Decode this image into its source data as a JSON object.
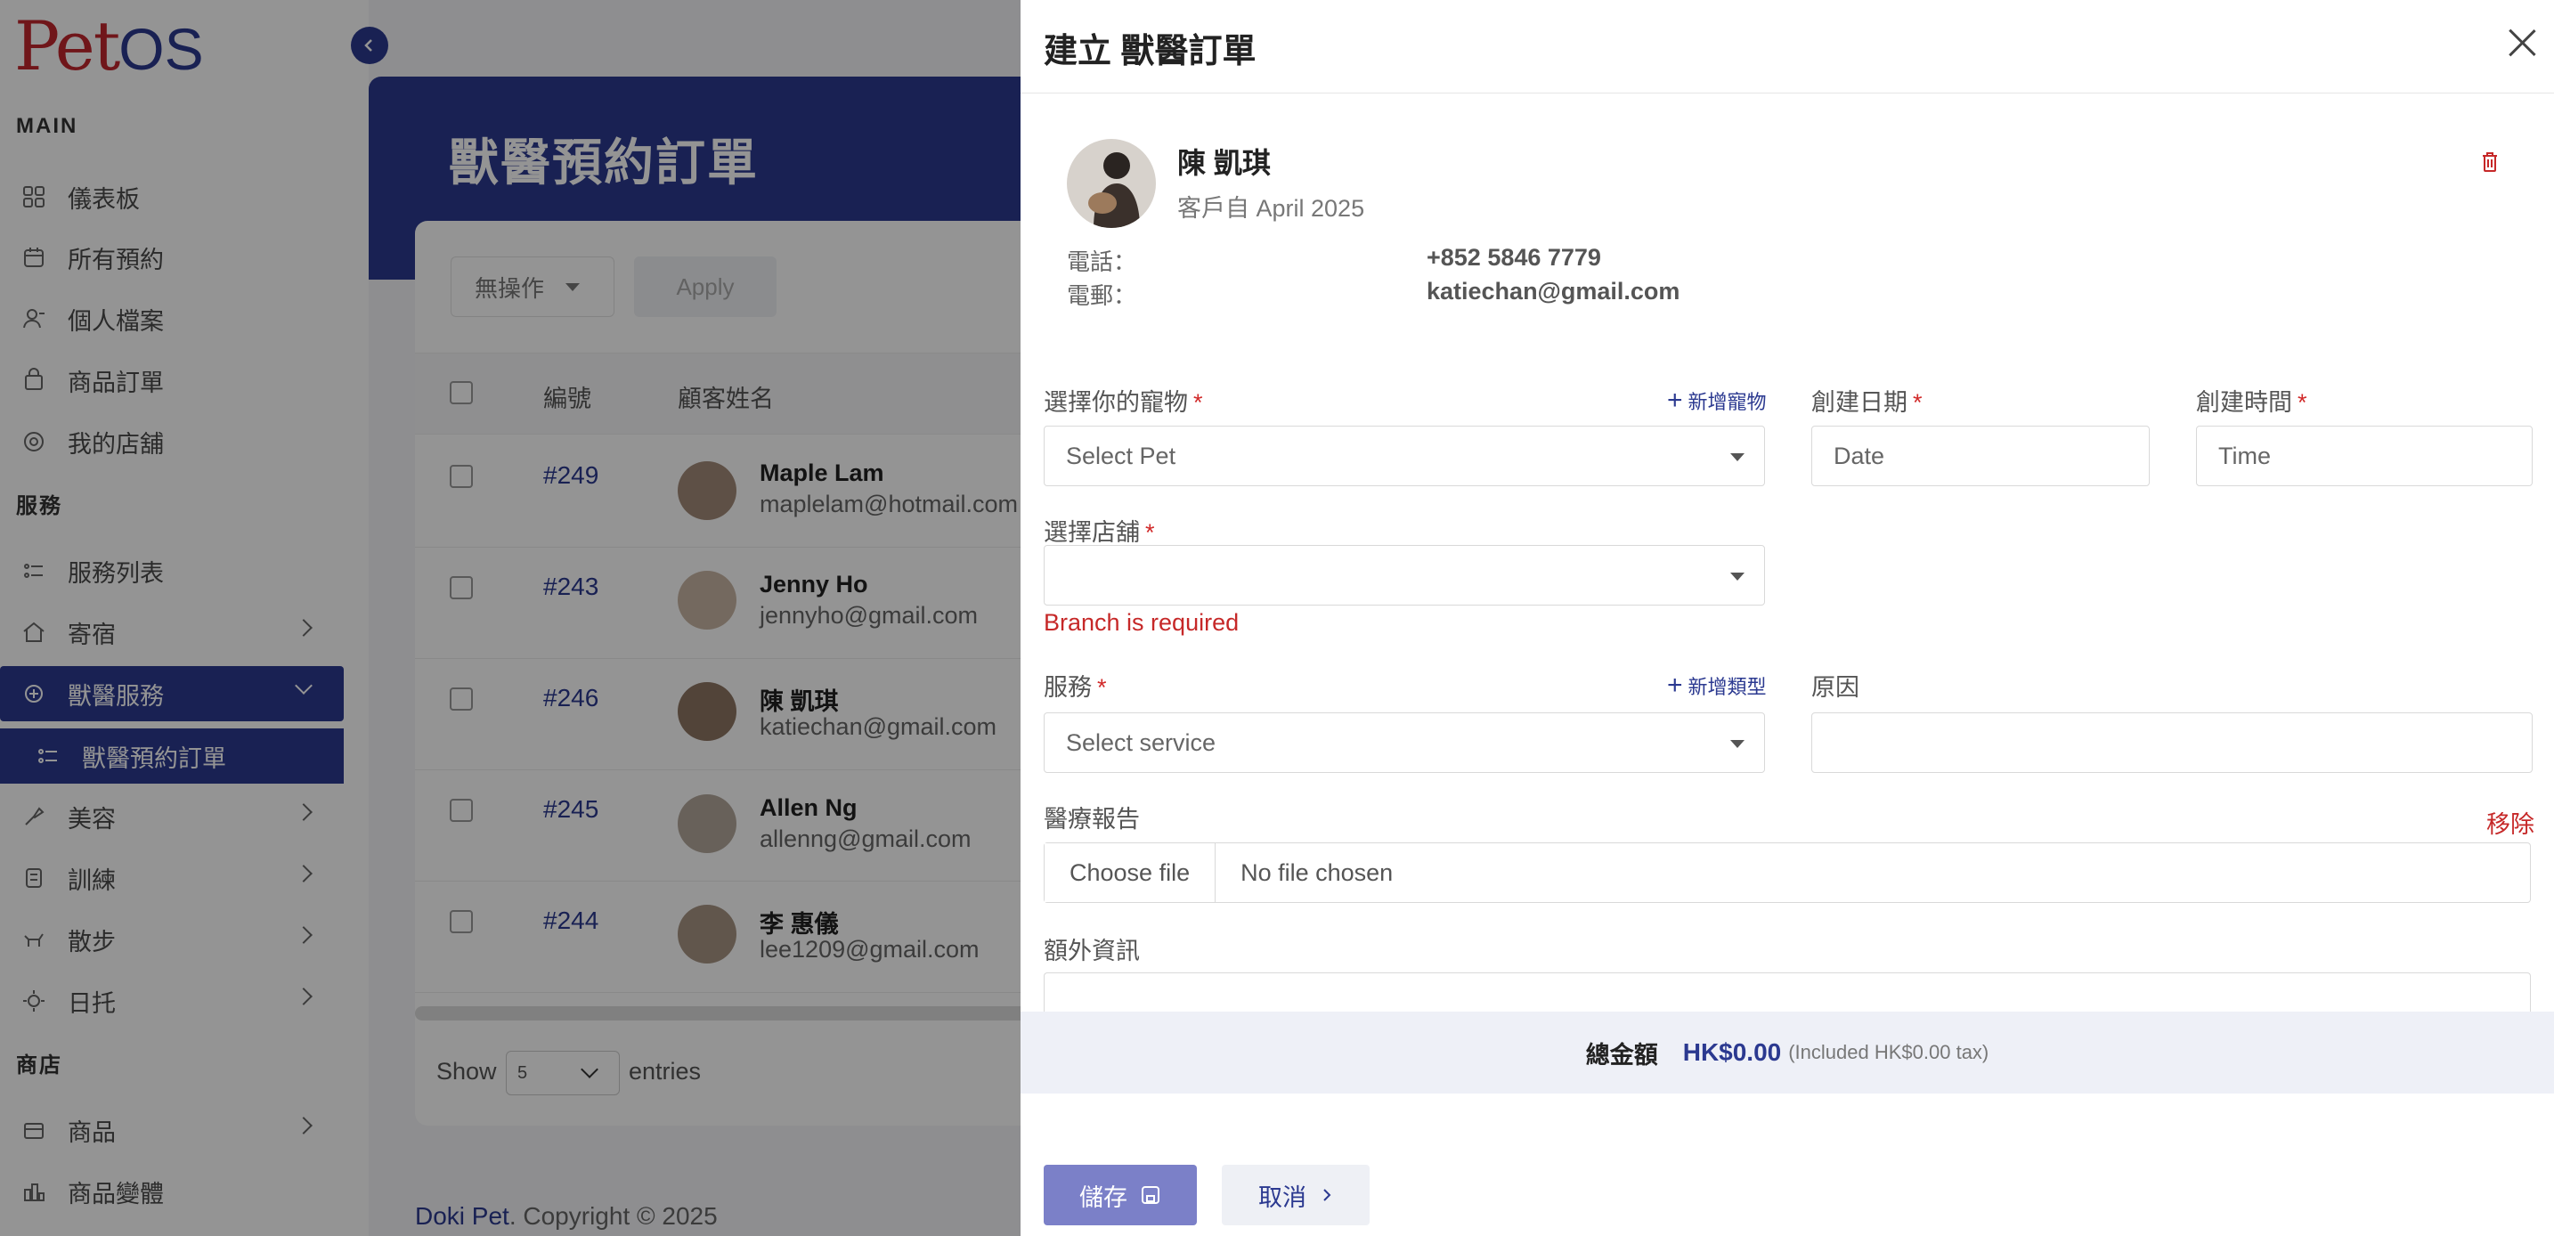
{
  "sidebar": {
    "logo_text": "Pet",
    "logo_suffix": "OS",
    "sections": {
      "main": "MAIN",
      "services": "服務",
      "shop": "商店"
    },
    "items": [
      {
        "label": "儀表板"
      },
      {
        "label": "所有預約"
      },
      {
        "label": "個人檔案"
      },
      {
        "label": "商品訂單"
      },
      {
        "label": "我的店舖"
      },
      {
        "label": "服務列表"
      },
      {
        "label": "寄宿"
      },
      {
        "label": "獸醫服務"
      },
      {
        "label": "獸醫預約訂單"
      },
      {
        "label": "美容"
      },
      {
        "label": "訓練"
      },
      {
        "label": "散步"
      },
      {
        "label": "日托"
      },
      {
        "label": "商品"
      },
      {
        "label": "商品變體"
      }
    ]
  },
  "main": {
    "page_title": "獸醫預約訂單",
    "bulk_action": "無操作",
    "apply_label": "Apply",
    "columns": {
      "id": "編號",
      "name": "顧客姓名"
    },
    "rows": [
      {
        "id": "#249",
        "name": "Maple Lam",
        "email": "maplelam@hotmail.com"
      },
      {
        "id": "#243",
        "name": "Jenny Ho",
        "email": "jennyho@gmail.com"
      },
      {
        "id": "#246",
        "name": "陳 凱琪",
        "email": "katiechan@gmail.com"
      },
      {
        "id": "#245",
        "name": "Allen Ng",
        "email": "allenng@gmail.com"
      },
      {
        "id": "#244",
        "name": "李 惠儀",
        "email": "lee1209@gmail.com"
      }
    ],
    "show_label": "Show",
    "show_value": "5",
    "entries_label": "entries",
    "footer_brand": "Doki Pet",
    "footer_text": ". Copyright © 2025"
  },
  "drawer": {
    "title": "建立 獸醫訂單",
    "customer": {
      "name": "陳 凱琪",
      "since": "客戶自 April 2025",
      "phone_label": "電話：",
      "phone": "+852 5846 7779",
      "email_label": "電郵：",
      "email": "katiechan@gmail.com"
    },
    "pet_label": "選擇你的寵物",
    "add_pet": "新增寵物",
    "pet_placeholder": "Select Pet",
    "date_label": "創建日期",
    "date_placeholder": "Date",
    "time_label": "創建時間",
    "time_placeholder": "Time",
    "branch_label": "選擇店舖",
    "branch_error": "Branch is required",
    "service_label": "服務",
    "add_type": "新增類型",
    "service_placeholder": "Select service",
    "reason_label": "原因",
    "report_label": "醫療報告",
    "remove_label": "移除",
    "choose_file": "Choose file",
    "no_file": "No file chosen",
    "extra_label": "額外資訊",
    "total_label": "總金額",
    "total_amount": "HK$0.00",
    "total_tax": "(Included HK$0.00 tax)",
    "save_label": "儲存",
    "cancel_label": "取消",
    "required_mark": "*"
  },
  "colors": {
    "primary": "#2b3990",
    "logo_red": "#c1272d",
    "error": "#c62828",
    "highlight": "#b01c5c"
  }
}
